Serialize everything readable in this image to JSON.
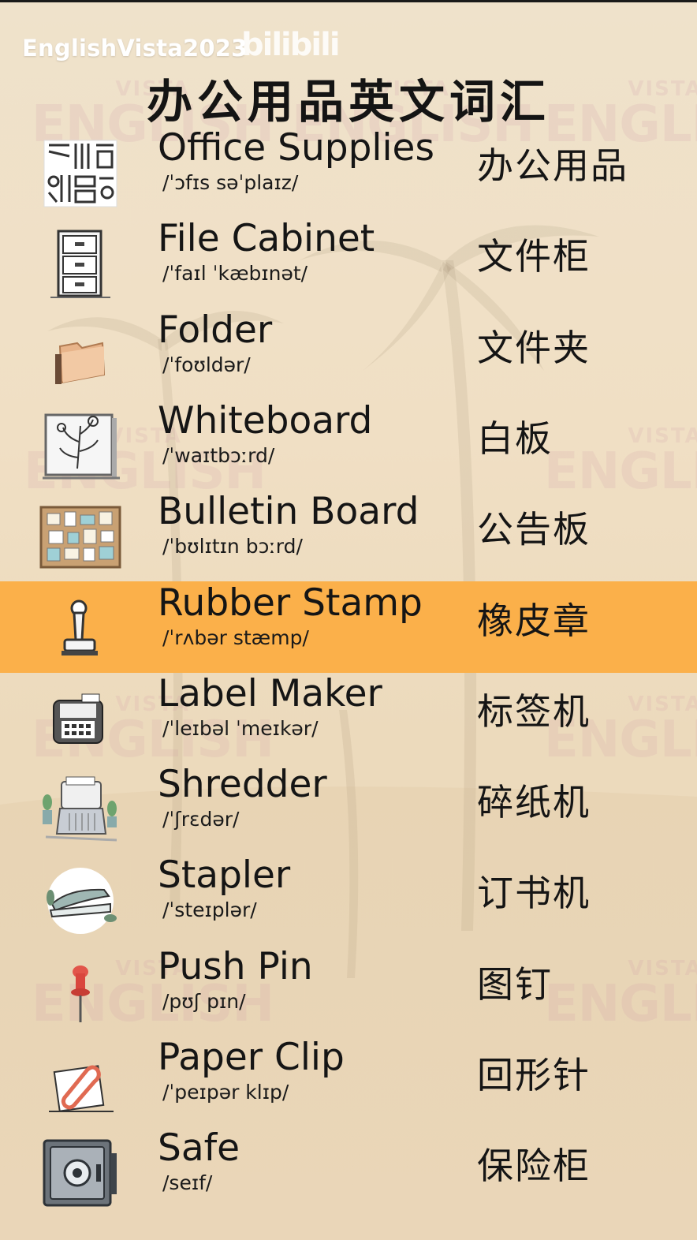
{
  "header": {
    "channel": "EnglishVista2023",
    "platform_logo": "bilibili",
    "title": "办公用品英文词汇"
  },
  "watermark": {
    "small": "VISTA",
    "big": "ENGLISH"
  },
  "highlight_color": "#fbb04a",
  "items": [
    {
      "en": "Office Supplies",
      "ipa": "/ˈɔfɪs səˈplaɪz/",
      "zh": "办公用品",
      "icon": "office-supplies-icon"
    },
    {
      "en": "File Cabinet",
      "ipa": "/ˈfaɪl ˈkæbɪnət/",
      "zh": "文件柜",
      "icon": "file-cabinet-icon"
    },
    {
      "en": "Folder",
      "ipa": "/ˈfoʊldər/",
      "zh": "文件夹",
      "icon": "folder-icon"
    },
    {
      "en": "Whiteboard",
      "ipa": "/ˈwaɪtbɔːrd/",
      "zh": "白板",
      "icon": "whiteboard-icon"
    },
    {
      "en": "Bulletin Board",
      "ipa": "/ˈbʊlɪtɪn bɔːrd/",
      "zh": "公告板",
      "icon": "bulletin-board-icon"
    },
    {
      "en": "Rubber Stamp",
      "ipa": "/ˈrʌbər stæmp/",
      "zh": "橡皮章",
      "icon": "rubber-stamp-icon",
      "highlighted": true
    },
    {
      "en": "Label Maker",
      "ipa": "/ˈleɪbəl ˈmeɪkər/",
      "zh": "标签机",
      "icon": "label-maker-icon"
    },
    {
      "en": "Shredder",
      "ipa": "/ˈʃrɛdər/",
      "zh": "碎纸机",
      "icon": "shredder-icon"
    },
    {
      "en": "Stapler",
      "ipa": "/ˈsteɪplər/",
      "zh": "订书机",
      "icon": "stapler-icon"
    },
    {
      "en": "Push Pin",
      "ipa": "/pʊʃ pɪn/",
      "zh": "图钉",
      "icon": "push-pin-icon"
    },
    {
      "en": "Paper Clip",
      "ipa": "/ˈpeɪpər klɪp/",
      "zh": "回形针",
      "icon": "paper-clip-icon"
    },
    {
      "en": "Safe",
      "ipa": "/seɪf/",
      "zh": "保险柜",
      "icon": "safe-icon"
    }
  ]
}
